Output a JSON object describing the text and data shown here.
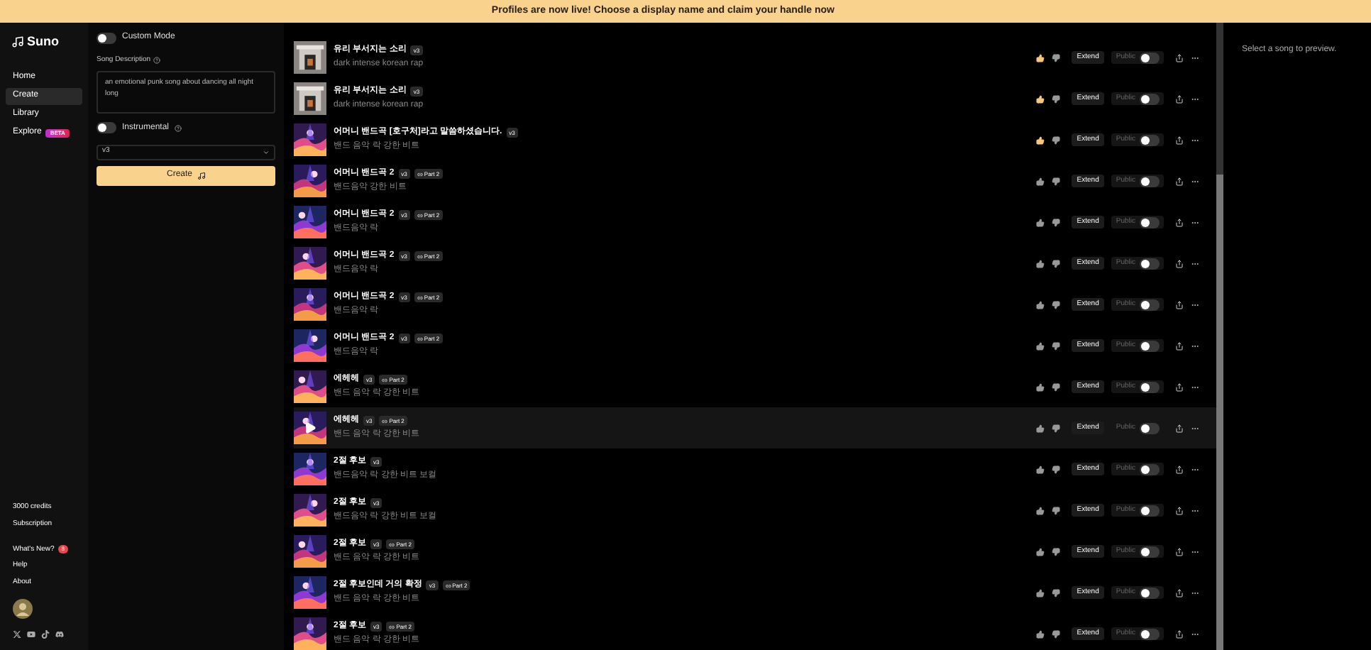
{
  "banner": "Profiles are now live! Choose a display name and claim your handle now",
  "sidebar": {
    "logo": "Suno",
    "items": [
      {
        "label": "Home",
        "selected": false
      },
      {
        "label": "Create",
        "selected": true
      },
      {
        "label": "Library",
        "selected": false
      },
      {
        "label": "Explore",
        "selected": false,
        "badge": "BETA"
      }
    ],
    "credits": "3000 credits",
    "subscription": "Subscription",
    "links": [
      {
        "label": "What's New?",
        "badge": "8"
      },
      {
        "label": "Help"
      },
      {
        "label": "About"
      }
    ]
  },
  "create": {
    "custom_mode": {
      "label": "Custom Mode",
      "on": false
    },
    "description_label": "Song Description",
    "description": "an emotional punk song about dancing all night long",
    "instrumental": {
      "label": "Instrumental",
      "on": false
    },
    "model": "v3",
    "button": "Create"
  },
  "songs": [
    {
      "title": "유리 부서지는 소리",
      "version": "v3",
      "tags": "dark intense korean rap",
      "liked": true,
      "highlighted": false,
      "extend": "Extend",
      "public_label": "Public",
      "public": false
    },
    {
      "title": "유리 부서지는 소리",
      "version": "v3",
      "tags": "dark intense korean rap",
      "liked": true,
      "highlighted": false,
      "extend": "Extend",
      "public_label": "Public",
      "public": false
    },
    {
      "title": "어머니 밴드곡 [호구처]라고 말씀하셨습니다.",
      "version": "v3",
      "tags": "밴드 음악 락 강한 비트",
      "liked": true,
      "highlighted": false,
      "extend": "Extend",
      "public_label": "Public",
      "public": false
    },
    {
      "title": "어머니 밴드곡 2",
      "version": "v3",
      "part": "Part 2",
      "tags": "밴드음악 강한 비트",
      "liked": false,
      "highlighted": false,
      "extend": "Extend",
      "public_label": "Public",
      "public": false
    },
    {
      "title": "어머니 밴드곡 2",
      "version": "v3",
      "part": "Part 2",
      "tags": "밴드음악 락",
      "liked": false,
      "highlighted": false,
      "extend": "Extend",
      "public_label": "Public",
      "public": false
    },
    {
      "title": "어머니 밴드곡 2",
      "version": "v3",
      "part": "Part 2",
      "tags": "밴드음악 락",
      "liked": false,
      "highlighted": false,
      "extend": "Extend",
      "public_label": "Public",
      "public": false
    },
    {
      "title": "어머니 밴드곡 2",
      "version": "v3",
      "part": "Part 2",
      "tags": "밴드음악 락",
      "liked": false,
      "highlighted": false,
      "extend": "Extend",
      "public_label": "Public",
      "public": false
    },
    {
      "title": "어머니 밴드곡 2",
      "version": "v3",
      "part": "Part 2",
      "tags": "밴드음악 락",
      "liked": false,
      "highlighted": false,
      "extend": "Extend",
      "public_label": "Public",
      "public": false
    },
    {
      "title": "에헤헤",
      "version": "v3",
      "part": "Part 2",
      "tags": "밴드 음악 락 강한 비트",
      "liked": false,
      "highlighted": false,
      "extend": "Extend",
      "public_label": "Public",
      "public": false
    },
    {
      "title": "에헤헤",
      "version": "v3",
      "part": "Part 2",
      "tags": "밴드 음악 락 강한 비트",
      "liked": false,
      "highlighted": true,
      "extend": "Extend",
      "public_label": "Public",
      "public": false
    },
    {
      "title": "2절 후보",
      "version": "v3",
      "tags": "밴드음악 락 강한 비트 보컬",
      "liked": false,
      "highlighted": false,
      "extend": "Extend",
      "public_label": "Public",
      "public": false
    },
    {
      "title": "2절 후보",
      "version": "v3",
      "tags": "밴드음악 락 강한 비트 보컬",
      "liked": false,
      "highlighted": false,
      "extend": "Extend",
      "public_label": "Public",
      "public": false
    },
    {
      "title": "2절 후보",
      "version": "v3",
      "part": "Part 2",
      "tags": "밴드 음악 락 강한 비트",
      "liked": false,
      "highlighted": false,
      "extend": "Extend",
      "public_label": "Public",
      "public": false
    },
    {
      "title": "2절 후보인데 거의 확정",
      "version": "v3",
      "part": "Part 2",
      "tags": "밴드 음악 락 강한 비트",
      "liked": false,
      "highlighted": false,
      "extend": "Extend",
      "public_label": "Public",
      "public": false
    },
    {
      "title": "2절 후보",
      "version": "v3",
      "part": "Part 2",
      "tags": "밴드 음악 락 강한 비트",
      "liked": false,
      "highlighted": false,
      "extend": "Extend",
      "public_label": "Public",
      "public": false
    }
  ],
  "preview": "Select a song to preview."
}
